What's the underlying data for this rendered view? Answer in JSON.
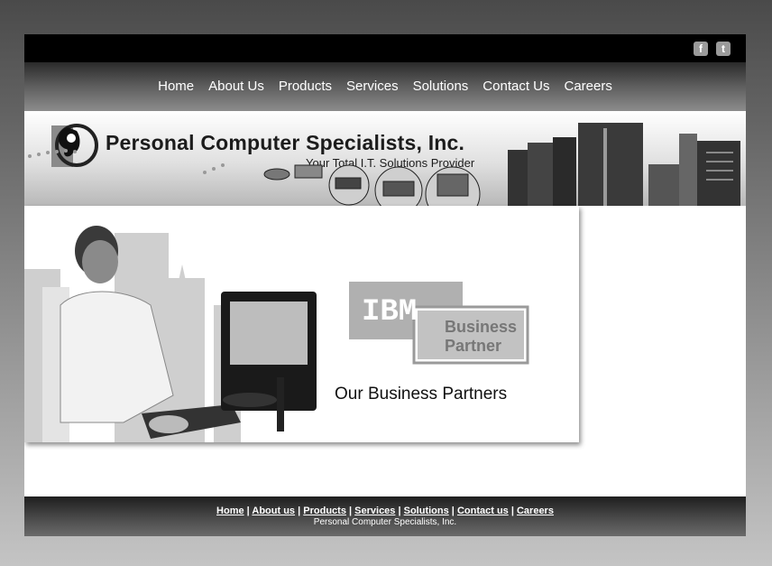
{
  "social": {
    "facebook": "f",
    "twitter": "t"
  },
  "nav": [
    {
      "label": "Home"
    },
    {
      "label": "About Us"
    },
    {
      "label": "Products"
    },
    {
      "label": "Services"
    },
    {
      "label": "Solutions"
    },
    {
      "label": "Contact Us"
    },
    {
      "label": "Careers"
    }
  ],
  "banner": {
    "company_name": "Personal Computer Specialists, Inc.",
    "tagline": "Your Total I.T. Solutions Provider"
  },
  "main": {
    "ibm_text": "IBM",
    "business_partner_line1": "Business",
    "business_partner_line2": "Partner",
    "section_title": "Our Business Partners"
  },
  "footer": {
    "links": [
      "Home",
      "About us",
      "Products",
      "Services",
      "Solutions",
      "Contact us",
      "Careers"
    ],
    "separator": " | ",
    "copyright": "Personal Computer Specialists, Inc."
  }
}
